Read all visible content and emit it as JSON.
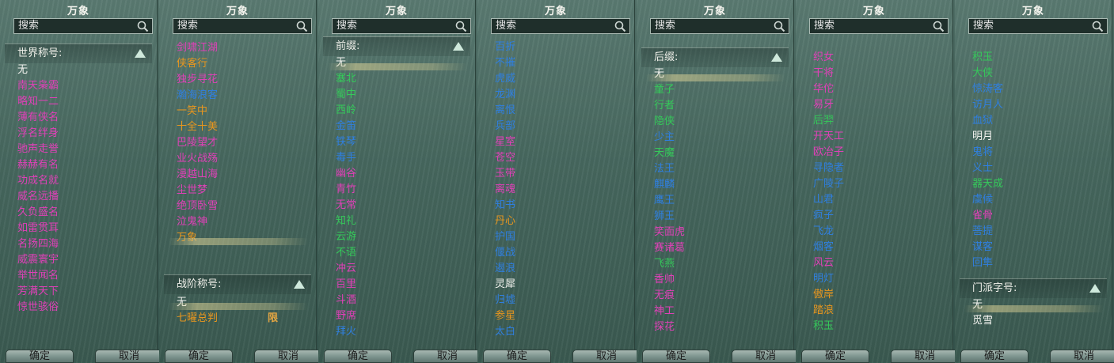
{
  "panels": [
    {
      "title": "万象",
      "search_placeholder": "搜索",
      "section": "世界称号:",
      "items": [
        {
          "t": "无",
          "c": "white"
        },
        {
          "t": "南天枭霸",
          "c": "pink"
        },
        {
          "t": "略知一二",
          "c": "pink"
        },
        {
          "t": "薄有侠名",
          "c": "pink"
        },
        {
          "t": "浮名绊身",
          "c": "pink"
        },
        {
          "t": "驰声走誉",
          "c": "pink"
        },
        {
          "t": "赫赫有名",
          "c": "pink"
        },
        {
          "t": "功成名就",
          "c": "pink"
        },
        {
          "t": "威名远播",
          "c": "pink"
        },
        {
          "t": "久负盛名",
          "c": "pink"
        },
        {
          "t": "如雷贯耳",
          "c": "pink"
        },
        {
          "t": "名扬四海",
          "c": "pink"
        },
        {
          "t": "威震寰宇",
          "c": "pink"
        },
        {
          "t": "举世闻名",
          "c": "pink"
        },
        {
          "t": "芳满天下",
          "c": "pink"
        },
        {
          "t": "惊世骇俗",
          "c": "pink"
        }
      ],
      "ok": "确定",
      "cancel": "取消"
    },
    {
      "title": "万象",
      "search_placeholder": "搜索",
      "items": [
        {
          "t": "剑啸江湖",
          "c": "pink"
        },
        {
          "t": "侠客行",
          "c": "orange"
        },
        {
          "t": "独步寻花",
          "c": "pink"
        },
        {
          "t": "瀚海浪客",
          "c": "blue"
        },
        {
          "t": "一笑中",
          "c": "orange"
        },
        {
          "t": "十全十美",
          "c": "orange"
        },
        {
          "t": "巴陵望才",
          "c": "pink"
        },
        {
          "t": "业火战殇",
          "c": "pink"
        },
        {
          "t": "漫越山海",
          "c": "pink"
        },
        {
          "t": "尘世梦",
          "c": "pink"
        },
        {
          "t": "绝顶卧雪",
          "c": "pink"
        },
        {
          "t": "泣鬼神",
          "c": "pink"
        },
        {
          "t": "万象",
          "c": "orange",
          "sel": true
        }
      ],
      "section2": "战阶称号:",
      "items2": [
        {
          "t": "无",
          "c": "white",
          "sel": true
        },
        {
          "t": "七曜总判",
          "c": "orange",
          "badge": "限"
        }
      ],
      "ok": "确定",
      "cancel": "取消"
    },
    {
      "title": "万象",
      "search_placeholder": "搜索",
      "section": "前缀:",
      "items": [
        {
          "t": "无",
          "c": "white",
          "sel": true
        },
        {
          "t": "塞北",
          "c": "green"
        },
        {
          "t": "蜀中",
          "c": "green"
        },
        {
          "t": "西岭",
          "c": "green"
        },
        {
          "t": "金笛",
          "c": "blue"
        },
        {
          "t": "铁琴",
          "c": "blue"
        },
        {
          "t": "毒手",
          "c": "blue"
        },
        {
          "t": "幽谷",
          "c": "pink"
        },
        {
          "t": "青竹",
          "c": "pink"
        },
        {
          "t": "无常",
          "c": "pink"
        },
        {
          "t": "知礼",
          "c": "green"
        },
        {
          "t": "云游",
          "c": "green"
        },
        {
          "t": "不语",
          "c": "green"
        },
        {
          "t": "冲云",
          "c": "pink"
        },
        {
          "t": "百里",
          "c": "pink"
        },
        {
          "t": "斗酒",
          "c": "pink"
        },
        {
          "t": "野席",
          "c": "pink"
        },
        {
          "t": "拜火",
          "c": "blue"
        }
      ],
      "ok": "确定",
      "cancel": "取消"
    },
    {
      "title": "万象",
      "search_placeholder": "搜索",
      "items": [
        {
          "t": "百折",
          "c": "blue"
        },
        {
          "t": "不摧",
          "c": "blue"
        },
        {
          "t": "虎威",
          "c": "blue"
        },
        {
          "t": "龙渊",
          "c": "blue"
        },
        {
          "t": "离恨",
          "c": "blue"
        },
        {
          "t": "兵部",
          "c": "blue"
        },
        {
          "t": "星室",
          "c": "pink"
        },
        {
          "t": "苍空",
          "c": "pink"
        },
        {
          "t": "玉带",
          "c": "pink"
        },
        {
          "t": "离魂",
          "c": "pink"
        },
        {
          "t": "知书",
          "c": "blue"
        },
        {
          "t": "丹心",
          "c": "orange"
        },
        {
          "t": "护国",
          "c": "blue"
        },
        {
          "t": "偃战",
          "c": "blue"
        },
        {
          "t": "遏浪",
          "c": "blue"
        },
        {
          "t": "灵犀",
          "c": "white"
        },
        {
          "t": "归墟",
          "c": "blue"
        },
        {
          "t": "参星",
          "c": "orange"
        },
        {
          "t": "太白",
          "c": "blue"
        }
      ],
      "ok": "确定",
      "cancel": "取消"
    },
    {
      "title": "万象",
      "search_placeholder": "搜索",
      "section": "后缀:",
      "items": [
        {
          "t": "无",
          "c": "white",
          "sel": true
        },
        {
          "t": "童子",
          "c": "green"
        },
        {
          "t": "行者",
          "c": "green"
        },
        {
          "t": "隐侠",
          "c": "green"
        },
        {
          "t": "少主",
          "c": "blue"
        },
        {
          "t": "天魔",
          "c": "green"
        },
        {
          "t": "法王",
          "c": "blue"
        },
        {
          "t": "麒麟",
          "c": "blue"
        },
        {
          "t": "鹰王",
          "c": "blue"
        },
        {
          "t": "狮王",
          "c": "blue"
        },
        {
          "t": "笑面虎",
          "c": "pink"
        },
        {
          "t": "赛诸葛",
          "c": "pink"
        },
        {
          "t": "飞燕",
          "c": "green"
        },
        {
          "t": "香帅",
          "c": "pink"
        },
        {
          "t": "无痕",
          "c": "pink"
        },
        {
          "t": "神工",
          "c": "pink"
        },
        {
          "t": "探花",
          "c": "pink"
        }
      ],
      "ok": "确定",
      "cancel": "取消"
    },
    {
      "title": "万象",
      "search_placeholder": "搜索",
      "items": [
        {
          "t": "织女",
          "c": "pink"
        },
        {
          "t": "干将",
          "c": "pink"
        },
        {
          "t": "华佗",
          "c": "pink"
        },
        {
          "t": "易牙",
          "c": "pink"
        },
        {
          "t": "后羿",
          "c": "green"
        },
        {
          "t": "开天工",
          "c": "pink"
        },
        {
          "t": "欧冶子",
          "c": "pink"
        },
        {
          "t": "寻隐者",
          "c": "blue"
        },
        {
          "t": "广陵子",
          "c": "blue"
        },
        {
          "t": "山君",
          "c": "blue"
        },
        {
          "t": "疯子",
          "c": "blue"
        },
        {
          "t": "飞龙",
          "c": "blue"
        },
        {
          "t": "烟客",
          "c": "blue"
        },
        {
          "t": "风云",
          "c": "pink"
        },
        {
          "t": "明灯",
          "c": "blue"
        },
        {
          "t": "傲岸",
          "c": "orange"
        },
        {
          "t": "踏浪",
          "c": "orange"
        },
        {
          "t": "积玉",
          "c": "green"
        }
      ],
      "ok": "确定",
      "cancel": "取消"
    },
    {
      "title": "万象",
      "search_placeholder": "搜索",
      "items": [
        {
          "t": "积玉",
          "c": "green"
        },
        {
          "t": "大侠",
          "c": "green"
        },
        {
          "t": "惊涛客",
          "c": "blue"
        },
        {
          "t": "访月人",
          "c": "blue"
        },
        {
          "t": "血狱",
          "c": "blue"
        },
        {
          "t": "明月",
          "c": "white"
        },
        {
          "t": "鬼将",
          "c": "blue"
        },
        {
          "t": "义士",
          "c": "blue"
        },
        {
          "t": "器天成",
          "c": "green"
        },
        {
          "t": "虞候",
          "c": "blue"
        },
        {
          "t": "雀骨",
          "c": "pink"
        },
        {
          "t": "菩提",
          "c": "blue"
        },
        {
          "t": "谋客",
          "c": "blue"
        },
        {
          "t": "回隼",
          "c": "blue"
        }
      ],
      "section2": "门派字号:",
      "items2": [
        {
          "t": "无",
          "c": "white",
          "sel": true
        },
        {
          "t": "觅雪",
          "c": "white"
        }
      ],
      "ok": "确定",
      "cancel": "取消"
    }
  ]
}
